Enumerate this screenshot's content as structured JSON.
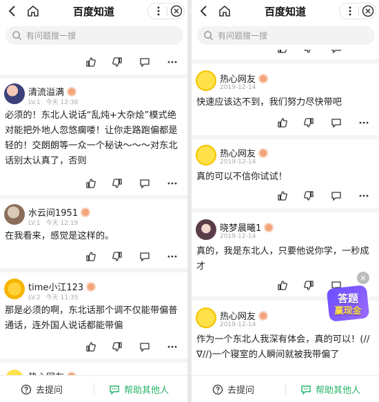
{
  "app": {
    "title": "百度知道",
    "search_placeholder": "有问题搜一搜"
  },
  "bottom": {
    "ask_label": "去提问",
    "help_label": "帮助其他人"
  },
  "left": {
    "answers": [
      {
        "name": "清流溢满",
        "level": "LV.1",
        "time": "今天 12:36",
        "text": "必须的！东北人说话“乱炖+大杂烩”模式绝对能把外地人忽悠瘸喽！让你走路跑偏都是轻的！交朗朗等一众一个秘诀～～～对东北话别太认真了，否则"
      },
      {
        "name": "水云间1951",
        "level": "LV.1",
        "time": "今天 12:19",
        "text": "在我看来，感觉是这样的。"
      },
      {
        "name": "time小江123",
        "level": "LV.2",
        "time": "今天 11:35",
        "text": "那是必须的啊，东北话那个调不仅能带偏普通话，连外国人说话都能带偏"
      },
      {
        "name": "热心网友"
      }
    ]
  },
  "right": {
    "answers": [
      {
        "name": "热心网友",
        "time": "2019-12-14",
        "text": "快速应该达不到，我们努力尽快带吧"
      },
      {
        "name": "热心网友",
        "time": "2019-12-14",
        "text": "真的可以不信你试试！"
      },
      {
        "name": "晓梦晨曦1",
        "time": "2019-12-14",
        "text": "真的，我是东北人，只要他说你学，一秒成才"
      },
      {
        "name": "热心网友",
        "time": "2019-12-14",
        "text": "作为一个东北人我深有体会，真的可以！(//∇//)一个寝室的人瞬间就被我带偏了"
      }
    ]
  },
  "promo": {
    "line1": "答题",
    "line2": "赢现金"
  },
  "colors": {
    "accent_green": "#27b36a",
    "medal": "#f2a47a"
  }
}
